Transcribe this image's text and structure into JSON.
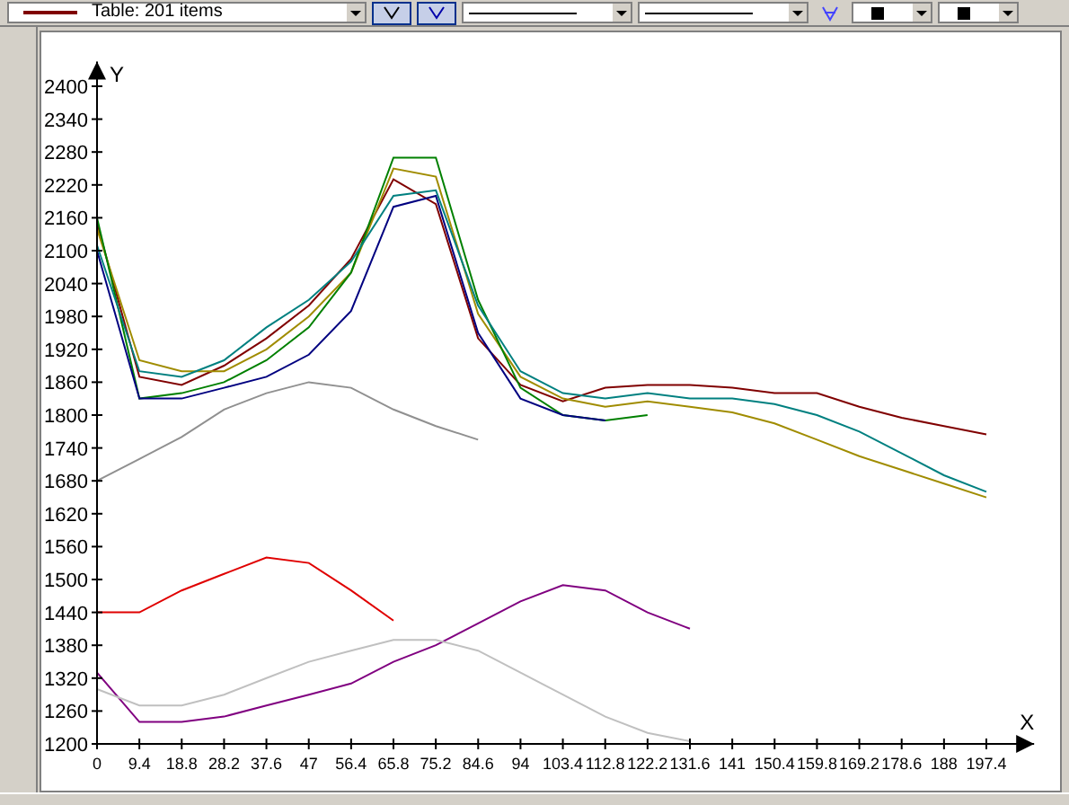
{
  "toolbar": {
    "table_combo": "Table: 201 items"
  },
  "chart": {
    "chart_data": {
      "type": "line",
      "xlabel": "X",
      "ylabel": "Y",
      "x": [
        0,
        9.4,
        18.8,
        28.2,
        37.6,
        47,
        56.4,
        65.8,
        75.2,
        84.6,
        94,
        103.4,
        112.8,
        122.2,
        131.6,
        141,
        150.4,
        159.8,
        169.2,
        178.6,
        188,
        197.4
      ],
      "series": [
        {
          "color": "#800000",
          "values": [
            2150,
            1870,
            1855,
            1890,
            1940,
            2000,
            2085,
            2230,
            2185,
            1940,
            1855,
            1825,
            1850,
            1855,
            1855,
            1850,
            1840,
            1840,
            1815,
            1795,
            1780,
            1765
          ]
        },
        {
          "color": "#a08c00",
          "values": [
            2140,
            1900,
            1880,
            1880,
            1920,
            1980,
            2060,
            2250,
            2235,
            1985,
            1870,
            1830,
            1815,
            1825,
            1815,
            1805,
            1785,
            1755,
            1725,
            1700,
            1675,
            1650
          ]
        },
        {
          "color": "#008000",
          "values": [
            2160,
            1830,
            1840,
            1860,
            1900,
            1960,
            2060,
            2270,
            2270,
            2010,
            1850,
            1800,
            1790,
            1800,
            null,
            null,
            null,
            null,
            null,
            null,
            null,
            null
          ]
        },
        {
          "color": "#008080",
          "values": [
            2110,
            1880,
            1870,
            1900,
            1960,
            2010,
            2080,
            2200,
            2210,
            2000,
            1880,
            1840,
            1830,
            1840,
            1830,
            1830,
            1820,
            1800,
            1770,
            1730,
            1690,
            1660
          ]
        },
        {
          "color": "#000080",
          "values": [
            2100,
            1830,
            1830,
            1850,
            1870,
            1910,
            1990,
            2180,
            2200,
            1950,
            1830,
            1800,
            1790,
            null,
            null,
            null,
            null,
            null,
            null,
            null,
            null,
            null
          ]
        },
        {
          "color": "#909090",
          "values": [
            1680,
            1720,
            1760,
            1810,
            1840,
            1860,
            1850,
            1810,
            1780,
            1755,
            null,
            null,
            null,
            null,
            null,
            null,
            null,
            null,
            null,
            null,
            null,
            null
          ]
        },
        {
          "color": "#e00000",
          "values": [
            1440,
            1440,
            1480,
            1510,
            1540,
            1530,
            1480,
            1425,
            null,
            null,
            null,
            null,
            null,
            null,
            null,
            null,
            null,
            null,
            null,
            null,
            null,
            null
          ]
        },
        {
          "color": "#800080",
          "values": [
            1330,
            1240,
            1240,
            1250,
            1270,
            1290,
            1310,
            1350,
            1380,
            1420,
            1460,
            1490,
            1480,
            1440,
            1410,
            null,
            null,
            null,
            null,
            null,
            null,
            null
          ]
        },
        {
          "color": "#c0c0c0",
          "values": [
            1300,
            1270,
            1270,
            1290,
            1320,
            1350,
            1370,
            1390,
            1390,
            1370,
            1330,
            1290,
            1250,
            1220,
            1205,
            null,
            null,
            null,
            null,
            null,
            null,
            null
          ]
        }
      ],
      "xlim": [
        0,
        208
      ],
      "ylim": [
        1200,
        2445
      ],
      "xticks": [
        0,
        9.4,
        18.8,
        28.2,
        37.6,
        47,
        56.4,
        65.8,
        75.2,
        84.6,
        94,
        103.4,
        112.8,
        122.2,
        131.6,
        141,
        150.4,
        159.8,
        169.2,
        178.6,
        188,
        197.4
      ],
      "yticks": [
        1200,
        1260,
        1320,
        1380,
        1440,
        1500,
        1560,
        1620,
        1680,
        1740,
        1800,
        1860,
        1920,
        1980,
        2040,
        2100,
        2160,
        2220,
        2280,
        2340,
        2400
      ]
    }
  }
}
